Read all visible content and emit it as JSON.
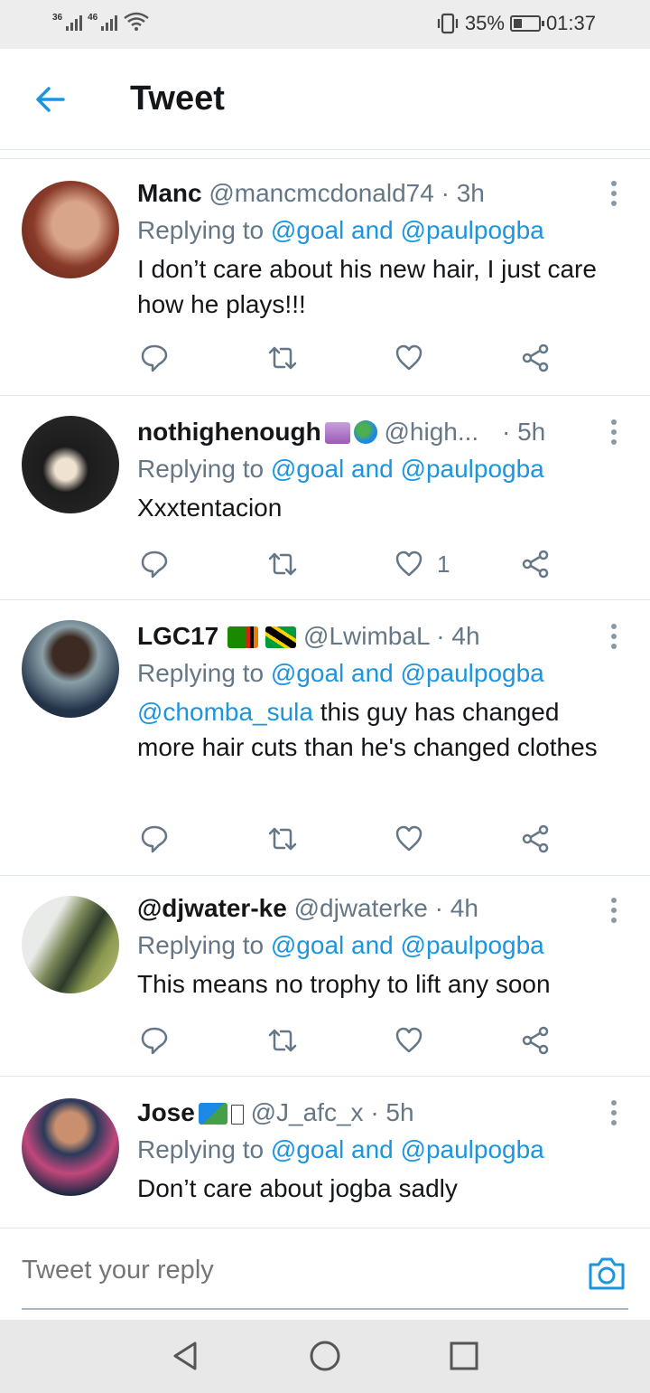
{
  "status_bar": {
    "signal1_label": "36",
    "signal2_label": "46",
    "battery_percent": "35%",
    "battery_level": 0.35,
    "time": "01:37"
  },
  "header": {
    "title": "Tweet",
    "back_icon": "arrow-left-icon"
  },
  "colors": {
    "accent": "#1b95e0",
    "secondary_text": "#657786",
    "divider": "#e1e8ed"
  },
  "tweets": [
    {
      "name": "Manc",
      "handle": "@mancmcdonald74",
      "time": "· 3h",
      "replying_prefix": "Replying to",
      "reply_user1": "@goal",
      "reply_and": "and",
      "reply_user2": "@paulpogba",
      "text": "I don’t care about his new hair, I just care how he plays!!!",
      "like_count": ""
    },
    {
      "name": "nothighenough",
      "handle": "@high...",
      "time": "· 5h",
      "replying_prefix": "Replying to",
      "reply_user1": "@goal",
      "reply_and": "and",
      "reply_user2": "@paulpogba",
      "text": "Xxxtentacion",
      "like_count": "1"
    },
    {
      "name": "LGC17",
      "handle": "@LwimbaL",
      "time": "· 4h",
      "replying_prefix": "Replying to",
      "reply_user1": "@goal",
      "reply_and": "and",
      "reply_user2": "@paulpogba",
      "text_mention": "@chomba_sula",
      "text": " this guy has changed more hair cuts than he's changed clothes",
      "like_count": ""
    },
    {
      "name": "@djwater-ke",
      "handle": "@djwaterke",
      "time": "· 4h",
      "replying_prefix": "Replying to",
      "reply_user1": "@goal",
      "reply_and": "and",
      "reply_user2": "@paulpogba",
      "text": "This means no trophy to lift any soon",
      "like_count": ""
    },
    {
      "name": "Jose",
      "handle": "@J_afc_x",
      "time": "· 5h",
      "replying_prefix": "Replying to",
      "reply_user1": "@goal",
      "reply_and": "and",
      "reply_user2": "@paulpogba",
      "text": "Don’t care about jogba sadly",
      "like_count": ""
    }
  ],
  "reply_bar": {
    "placeholder": "Tweet your reply",
    "camera_icon": "camera-icon"
  },
  "nav_bar": {
    "back": "triangle-back-icon",
    "home": "circle-home-icon",
    "recents": "square-recents-icon"
  }
}
